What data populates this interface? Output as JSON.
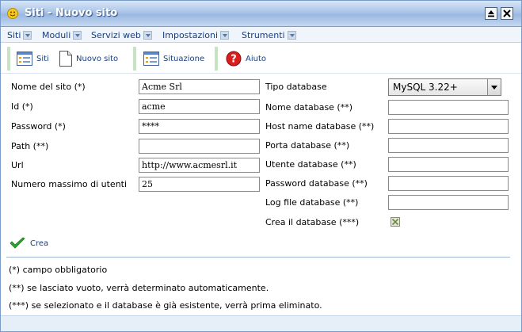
{
  "window": {
    "title": "Siti - Nuovo sito",
    "colors": {
      "titlebar": "#9ab8e0",
      "accent_text": "#1a3e7a",
      "toolbar_separator": "#c6e4c2"
    }
  },
  "menu": [
    {
      "label": "Siti"
    },
    {
      "label": "Moduli"
    },
    {
      "label": "Servizi web"
    },
    {
      "label": "Impostazioni"
    },
    {
      "label": "Strumenti"
    }
  ],
  "toolbar": {
    "siti_label": "Siti",
    "nuovo_label": "Nuovo sito",
    "situazione_label": "Situazione",
    "aiuto_label": "Aiuto"
  },
  "form": {
    "nome_sito": {
      "label": "Nome del sito (*)",
      "value": "Acme Srl"
    },
    "id": {
      "label": "Id (*)",
      "value": "acme"
    },
    "password": {
      "label": "Password (*)",
      "value": "****"
    },
    "path": {
      "label": "Path (**)",
      "value": ""
    },
    "url": {
      "label": "Url",
      "value": "http://www.acmesrl.it"
    },
    "max_utenti": {
      "label": "Numero massimo di utenti",
      "value": "25"
    },
    "tipo_db": {
      "label": "Tipo database",
      "value": "MySQL 3.22+"
    },
    "nome_db": {
      "label": "Nome database (**)",
      "value": ""
    },
    "host_db": {
      "label": "Host name database (**)",
      "value": ""
    },
    "porta_db": {
      "label": "Porta database (**)",
      "value": ""
    },
    "utente_db": {
      "label": "Utente database (**)",
      "value": ""
    },
    "password_db": {
      "label": "Password database (**)",
      "value": ""
    },
    "log_db": {
      "label": "Log file database (**)",
      "value": ""
    },
    "crea_db": {
      "label": "Crea il database (***)",
      "checked": true
    },
    "crea_button": "Crea"
  },
  "notes": {
    "n1": "(*) campo obbligatorio",
    "n2": "(**) se lasciato vuoto, verrà determinato automaticamente.",
    "n3": "(***) se selezionato e il database è già esistente, verrà prima eliminato."
  }
}
